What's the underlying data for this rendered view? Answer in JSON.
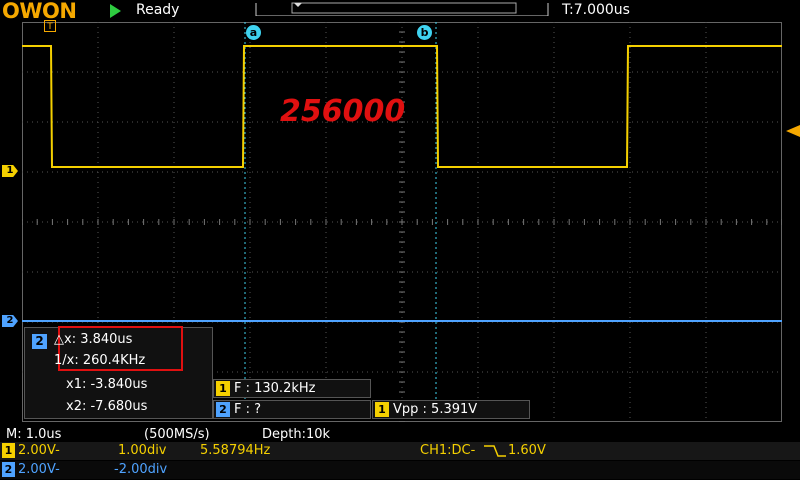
{
  "header": {
    "brand": "OWON",
    "status": "Ready",
    "timebase_offset": "T:7.000us"
  },
  "markers": {
    "ch1": "1",
    "ch2": "2",
    "trigger_pos": "T",
    "cursor_a": "a",
    "cursor_b": "b"
  },
  "overlay": {
    "value": "256000"
  },
  "cursor_panel": {
    "channel": "2",
    "delta_x": "△x: 3.840us",
    "inv_x": "1/x: 260.4KHz",
    "x1": "x1: -3.840us",
    "x2": "x2: -7.680us"
  },
  "measurements": [
    {
      "channel": "1",
      "text": "F : 130.2kHz"
    },
    {
      "channel": "2",
      "text": "F :    ?"
    },
    {
      "channel": "1",
      "text": "Vpp : 5.391V"
    }
  ],
  "bottom": {
    "timebase": "M: 1.0us",
    "sample_rate": "(500MS/s)",
    "depth": "Depth:10k",
    "ch1": {
      "num": "1",
      "volts": "2.00V-",
      "pos": "1.00div",
      "freq": "5.58794Hz",
      "trigger": "CH1:DC-",
      "trigger_level": "1.60V"
    },
    "ch2": {
      "num": "2",
      "volts": "2.00V-",
      "pos": "-2.00div"
    }
  },
  "colors": {
    "ch1": "#f5d000",
    "ch2": "#4fa3ff",
    "cursor": "#3fd3f0",
    "brand": "#f5a800",
    "highlight": "#e01010"
  }
}
